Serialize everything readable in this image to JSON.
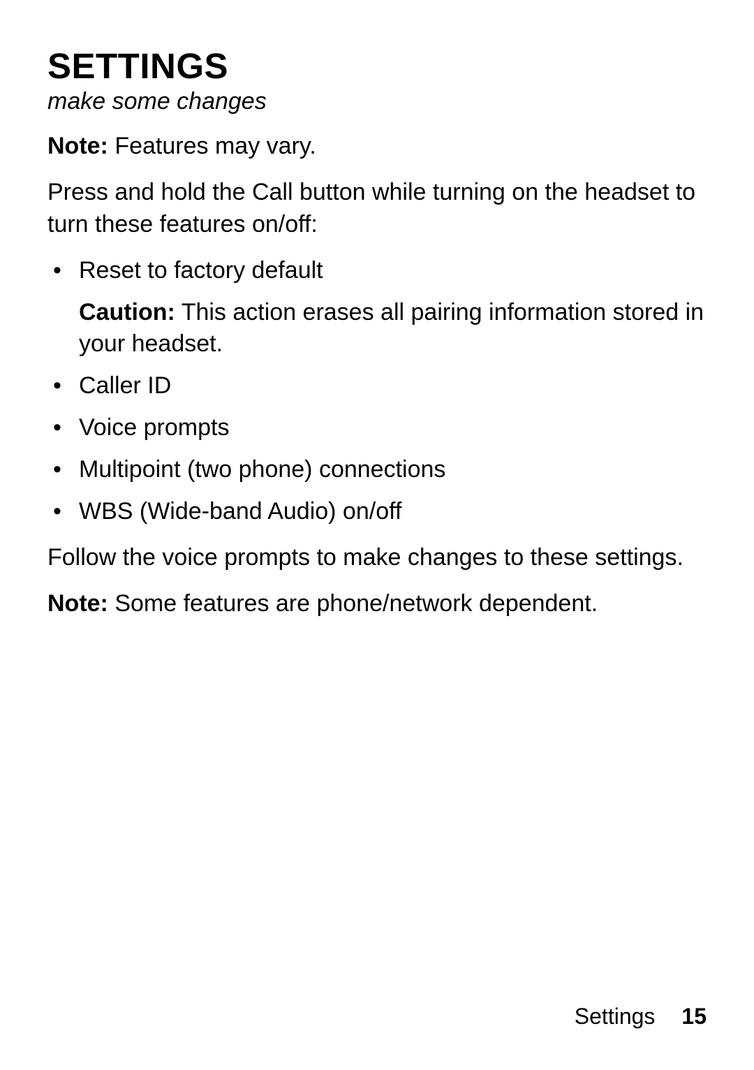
{
  "heading": "SETTINGS",
  "subtitle": "make some changes",
  "note1_label": "Note:",
  "note1_text": " Features may vary.",
  "intro": "Press and hold the Call button while turning on the headset to turn these features on/off:",
  "bullets": [
    {
      "text": "Reset to factory default",
      "caution_label": "Caution:",
      "caution_text": " This action erases all pairing information stored in your headset."
    },
    {
      "text": "Caller ID"
    },
    {
      "text": "Voice prompts"
    },
    {
      "text": "Multipoint (two phone) connections"
    },
    {
      "text": "WBS (Wide-band Audio) on/off"
    }
  ],
  "follow": "Follow the voice prompts to make changes to these settings.",
  "note2_label": "Note:",
  "note2_text": " Some features are phone/network dependent.",
  "footer": {
    "label": "Settings",
    "page": "15"
  }
}
